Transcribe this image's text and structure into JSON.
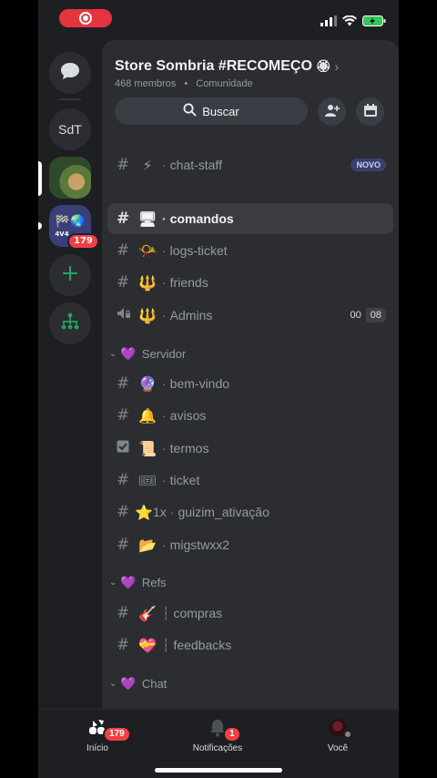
{
  "server": {
    "name": "Store Sombria #RECOMEÇO",
    "members": "468 membros",
    "kind": "Comunidade",
    "search_label": "Buscar"
  },
  "rail": {
    "servers": [
      {
        "id": "messages",
        "label": ""
      },
      {
        "id": "sdt",
        "label": "SdT"
      },
      {
        "id": "server-photo",
        "label": ""
      },
      {
        "id": "server-4v4",
        "label": "4V4",
        "badge": "179"
      }
    ]
  },
  "channels": [
    {
      "type": "text",
      "emoji": "⚡",
      "name": "chat-staff",
      "tag": "NOVO"
    },
    {
      "type": "text",
      "emoji": "🖥",
      "name": "comandos",
      "active": true
    },
    {
      "type": "text",
      "emoji": "📯",
      "name": "logs-ticket"
    },
    {
      "type": "text",
      "emoji": "🔱",
      "name": "friends"
    },
    {
      "type": "voice",
      "emoji": "🔱",
      "name": "Admins",
      "count_a": "00",
      "count_b": "08"
    }
  ],
  "categories": [
    {
      "emoji": "💜",
      "name": "Servidor"
    },
    {
      "emoji": "💜",
      "name": "Refs"
    },
    {
      "emoji": "💜",
      "name": "Chat"
    }
  ],
  "servidor_channels": [
    {
      "emoji": "🔮",
      "name": "bem-vindo",
      "type": "text"
    },
    {
      "emoji": "🔔",
      "name": "avisos",
      "type": "text"
    },
    {
      "emoji": "📜",
      "name": "termos",
      "type": "rules"
    },
    {
      "emoji": "🎟",
      "name": "ticket",
      "type": "text"
    },
    {
      "emoji": "⭐",
      "prefix": "1x",
      "name": "guizim_ativação",
      "type": "text"
    },
    {
      "emoji": "📂",
      "name": "migstwxx2",
      "type": "text"
    }
  ],
  "refs_channels": [
    {
      "emoji": "🎸",
      "name": "compras"
    },
    {
      "emoji": "💝",
      "name": "feedbacks"
    }
  ],
  "nav": {
    "home": "Início",
    "home_badge": "179",
    "notifications": "Notificações",
    "notif_badge": "1",
    "you": "Você"
  },
  "colors": {
    "accent_green": "#23a55a",
    "badge_red": "#f23f43",
    "recording_red": "#e5343e"
  }
}
